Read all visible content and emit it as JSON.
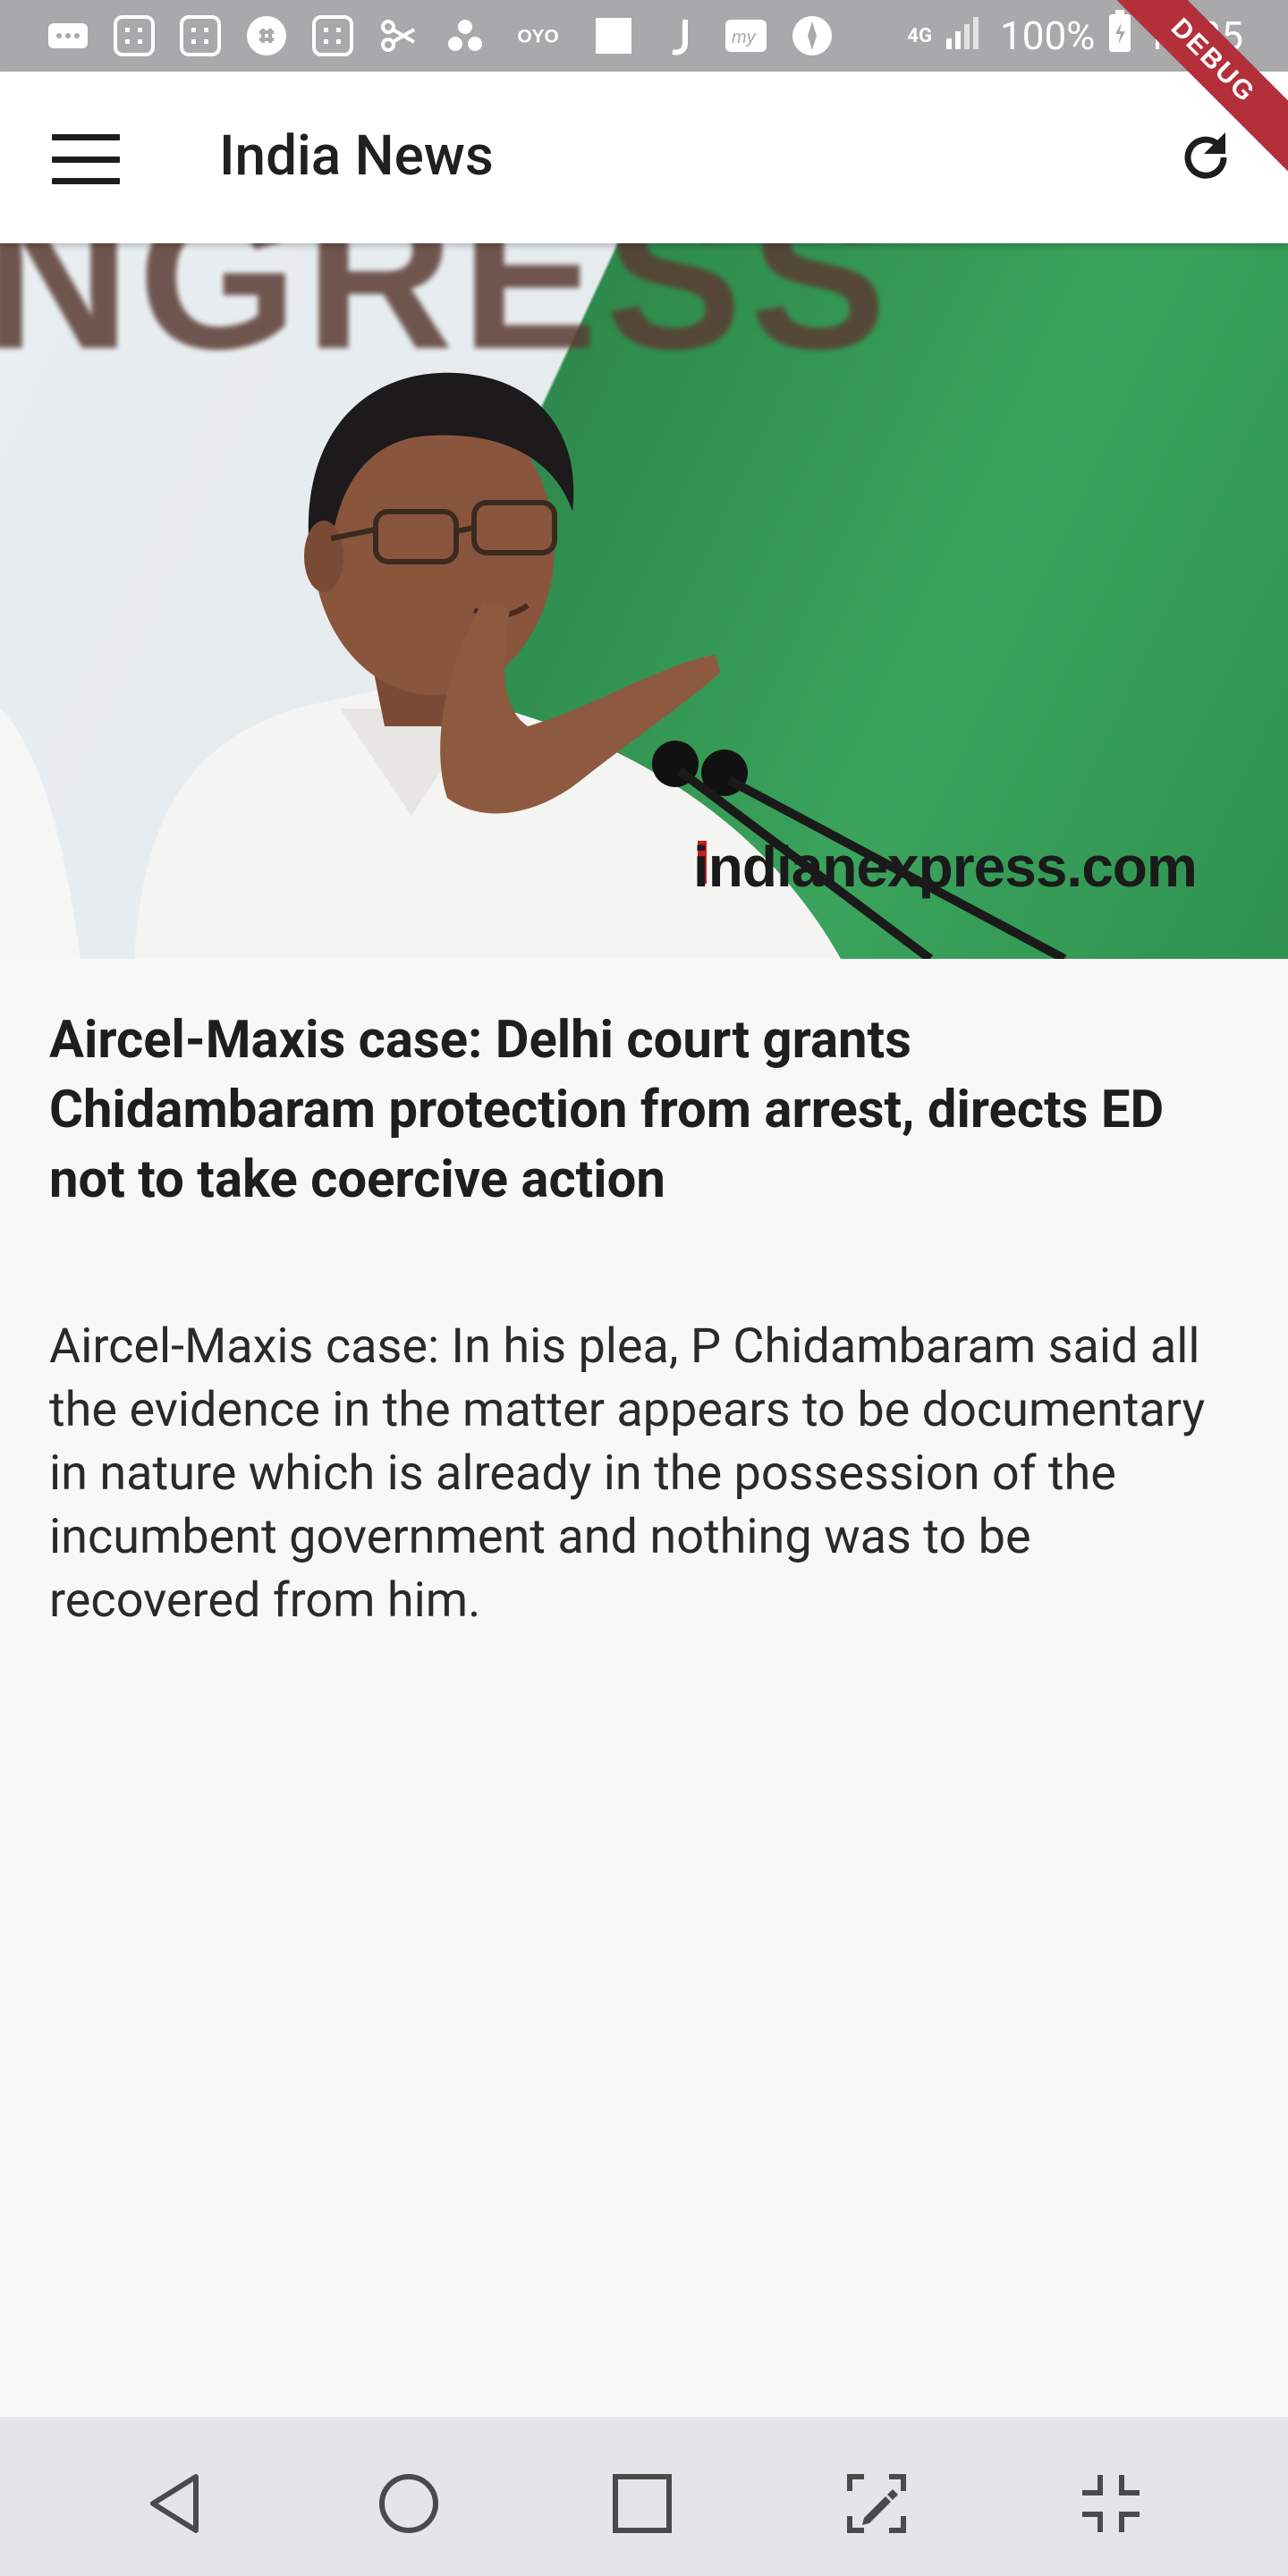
{
  "status_bar": {
    "battery": "100%",
    "time": "14:35",
    "network": "4G",
    "left_icons": [
      "message-icon",
      "calc-icon",
      "calc-icon",
      "slack-icon",
      "calc-icon",
      "scissor-icon",
      "dots-icon",
      "oyo-icon",
      "square-icon",
      "j-icon",
      "my-icon",
      "compass-icon"
    ]
  },
  "debug_label": "DEBUG",
  "app_bar": {
    "title": "India News",
    "menu_icon": "hamburger-icon",
    "refresh_icon": "refresh-icon"
  },
  "hero": {
    "background_text": "NGRESS",
    "watermark": "indianexpress.com"
  },
  "article": {
    "headline": "Aircel-Maxis case: Delhi court grants Chidambaram protection from arrest, directs ED not to take coercive action",
    "summary": "Aircel-Maxis case: In his plea, P Chidambaram said all the evidence in the matter appears to be documentary in nature which is already in the possession of the incumbent government and nothing was to be recovered from him."
  },
  "nav_bar": {
    "buttons": [
      "back-icon",
      "home-icon",
      "recents-icon",
      "edit-screenshot-icon",
      "collapse-icon"
    ]
  },
  "colors": {
    "status_bar_bg": "#a9a9ab",
    "app_bar_bg": "#ffffff",
    "body_bg": "#f8f8f9",
    "debug_ribbon": "#b3303a",
    "nav_bar_bg": "#e4e5e9"
  }
}
